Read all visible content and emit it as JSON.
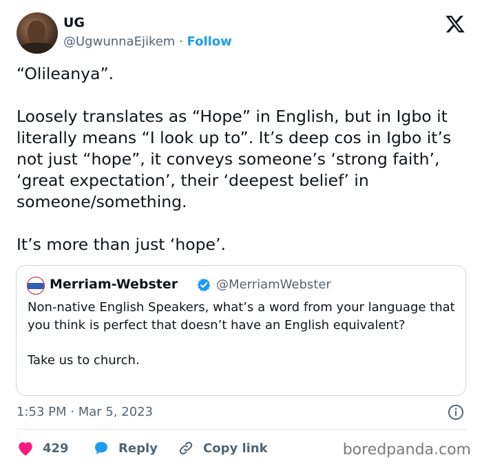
{
  "author": {
    "name": "UG",
    "handle": "@UgwunnaEjikem",
    "separator": " · ",
    "follow_label": "Follow",
    "avatar_icon": "user-avatar"
  },
  "platform_logo": "x-logo-icon",
  "tweet": {
    "text": "“Olileanya”.\n\nLoosely translates as “Hope” in English, but in Igbo it literally means “I look up to”. It’s deep cos in Igbo it’s not just “hope”, it conveys someone’s ‘strong faith’, ‘great expectation’, their ‘deepest belief’ in someone/something.\n\nIt’s more than just ‘hope’."
  },
  "quoted_tweet": {
    "name": "Merriam-Webster",
    "handle": "@MerriamWebster",
    "verified": true,
    "text": "Non-native English Speakers, what’s a word from your language that you think is perfect that doesn’t have an English equivalent?\n\nTake us to church."
  },
  "timestamp": "1:53 PM · Mar 5, 2023",
  "actions": {
    "like_count": "429",
    "reply_label": "Reply",
    "copy_link_label": "Copy link"
  },
  "watermark": "boredpanda.com",
  "colors": {
    "accent": "#1d9bf0",
    "like": "#f91880",
    "text": "#0f1419",
    "muted": "#536471"
  }
}
